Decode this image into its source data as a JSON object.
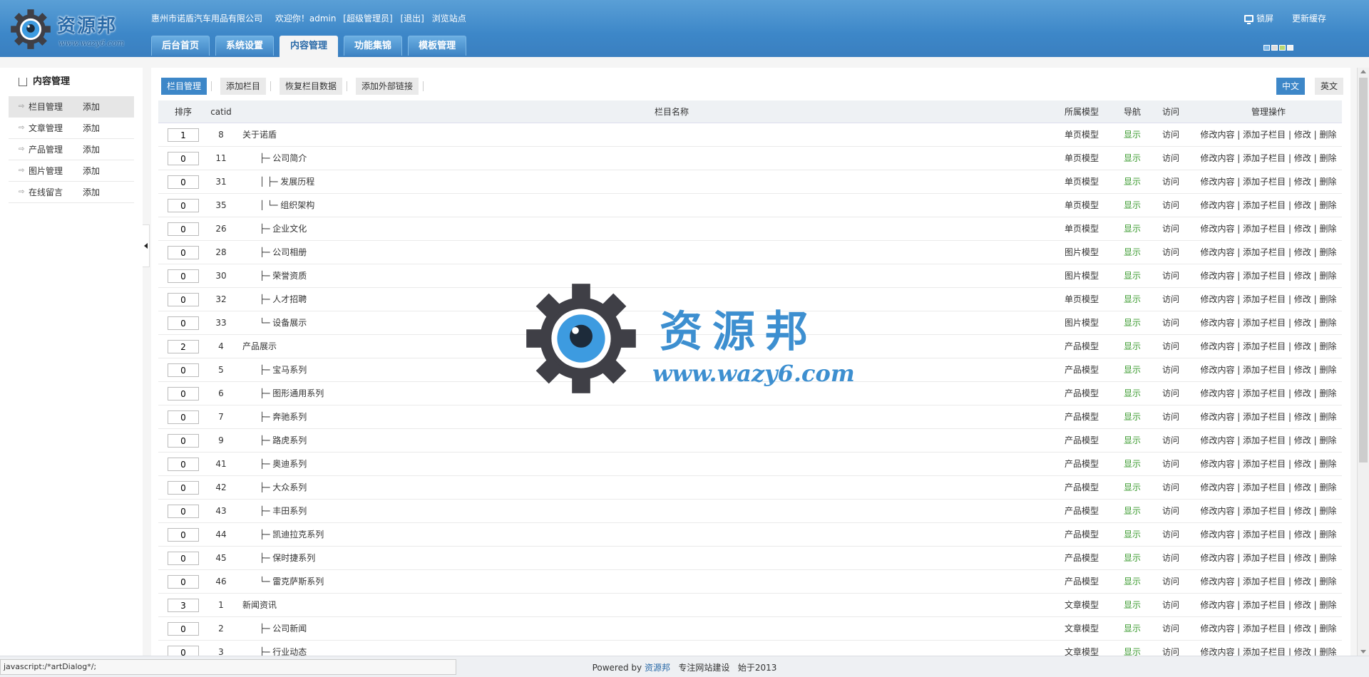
{
  "header": {
    "brand": "资源邦",
    "brand_url": "www.wazy6.com",
    "company": "惠州市诺盾汽车用品有限公司",
    "welcome": "欢迎你！admin",
    "role": "[超级管理员]",
    "logout": "[退出]",
    "browse": "浏览站点",
    "lock": "锁屏",
    "update_cache": "更新缓存",
    "accent": "#3d87c8"
  },
  "nav": {
    "tabs": [
      "后台首页",
      "系统设置",
      "内容管理",
      "功能集锦",
      "模板管理"
    ],
    "active": "内容管理"
  },
  "sidebar": {
    "title": "内容管理",
    "items": [
      {
        "label": "栏目管理",
        "add": "添加"
      },
      {
        "label": "文章管理",
        "add": "添加"
      },
      {
        "label": "产品管理",
        "add": "添加"
      },
      {
        "label": "图片管理",
        "add": "添加"
      },
      {
        "label": "在线留言",
        "add": "添加"
      }
    ]
  },
  "toolbar": {
    "buttons": [
      "栏目管理",
      "添加栏目",
      "恢复栏目数据",
      "添加外部链接"
    ],
    "lang_cn": "中文",
    "lang_en": "英文"
  },
  "table": {
    "headers": {
      "sort": "排序",
      "catid": "catid",
      "name": "栏目名称",
      "model": "所属模型",
      "nav": "导航",
      "visit": "访问",
      "ops": "管理操作"
    },
    "ops_text": "修改内容 | 添加子栏目 | 修改 | 删除",
    "rows": [
      {
        "sort": "1",
        "catid": "8",
        "name": "关于诺盾",
        "model": "单页模型",
        "nav": "显示",
        "visit": "访问"
      },
      {
        "sort": "0",
        "catid": "11",
        "name": "├─ 公司简介",
        "model": "单页模型",
        "nav": "显示",
        "visit": "访问"
      },
      {
        "sort": "0",
        "catid": "31",
        "name": "│     ├─ 发展历程",
        "model": "单页模型",
        "nav": "显示",
        "visit": "访问"
      },
      {
        "sort": "0",
        "catid": "35",
        "name": "│     └─ 组织架构",
        "model": "单页模型",
        "nav": "显示",
        "visit": "访问"
      },
      {
        "sort": "0",
        "catid": "26",
        "name": "├─ 企业文化",
        "model": "单页模型",
        "nav": "显示",
        "visit": "访问"
      },
      {
        "sort": "0",
        "catid": "28",
        "name": "├─ 公司相册",
        "model": "图片模型",
        "nav": "显示",
        "visit": "访问"
      },
      {
        "sort": "0",
        "catid": "30",
        "name": "├─ 荣誉资质",
        "model": "图片模型",
        "nav": "显示",
        "visit": "访问"
      },
      {
        "sort": "0",
        "catid": "32",
        "name": "├─ 人才招聘",
        "model": "单页模型",
        "nav": "显示",
        "visit": "访问"
      },
      {
        "sort": "0",
        "catid": "33",
        "name": "└─ 设备展示",
        "model": "图片模型",
        "nav": "显示",
        "visit": "访问"
      },
      {
        "sort": "2",
        "catid": "4",
        "name": "产品展示",
        "model": "产品模型",
        "nav": "显示",
        "visit": "访问"
      },
      {
        "sort": "0",
        "catid": "5",
        "name": "├─ 宝马系列",
        "model": "产品模型",
        "nav": "显示",
        "visit": "访问"
      },
      {
        "sort": "0",
        "catid": "6",
        "name": "├─ 图形通用系列",
        "model": "产品模型",
        "nav": "显示",
        "visit": "访问"
      },
      {
        "sort": "0",
        "catid": "7",
        "name": "├─ 奔驰系列",
        "model": "产品模型",
        "nav": "显示",
        "visit": "访问"
      },
      {
        "sort": "0",
        "catid": "9",
        "name": "├─ 路虎系列",
        "model": "产品模型",
        "nav": "显示",
        "visit": "访问"
      },
      {
        "sort": "0",
        "catid": "41",
        "name": "├─ 奥迪系列",
        "model": "产品模型",
        "nav": "显示",
        "visit": "访问"
      },
      {
        "sort": "0",
        "catid": "42",
        "name": "├─ 大众系列",
        "model": "产品模型",
        "nav": "显示",
        "visit": "访问"
      },
      {
        "sort": "0",
        "catid": "43",
        "name": "├─ 丰田系列",
        "model": "产品模型",
        "nav": "显示",
        "visit": "访问"
      },
      {
        "sort": "0",
        "catid": "44",
        "name": "├─ 凯迪拉克系列",
        "model": "产品模型",
        "nav": "显示",
        "visit": "访问"
      },
      {
        "sort": "0",
        "catid": "45",
        "name": "├─ 保时捷系列",
        "model": "产品模型",
        "nav": "显示",
        "visit": "访问"
      },
      {
        "sort": "0",
        "catid": "46",
        "name": "└─ 雷克萨斯系列",
        "model": "产品模型",
        "nav": "显示",
        "visit": "访问"
      },
      {
        "sort": "3",
        "catid": "1",
        "name": "新闻资讯",
        "model": "文章模型",
        "nav": "显示",
        "visit": "访问"
      },
      {
        "sort": "0",
        "catid": "2",
        "name": "├─ 公司新闻",
        "model": "文章模型",
        "nav": "显示",
        "visit": "访问"
      },
      {
        "sort": "0",
        "catid": "3",
        "name": "├─ 行业动态",
        "model": "文章模型",
        "nav": "显示",
        "visit": "访问"
      }
    ]
  },
  "footer": {
    "powered": "Powered by",
    "brand": "资源邦",
    "slogan": "专注网站建设",
    "since": "始于2013"
  },
  "statusbar": "javascript:/*artDialog*/;",
  "watermark": {
    "text": "资源邦",
    "url": "www.wazy6.com"
  }
}
